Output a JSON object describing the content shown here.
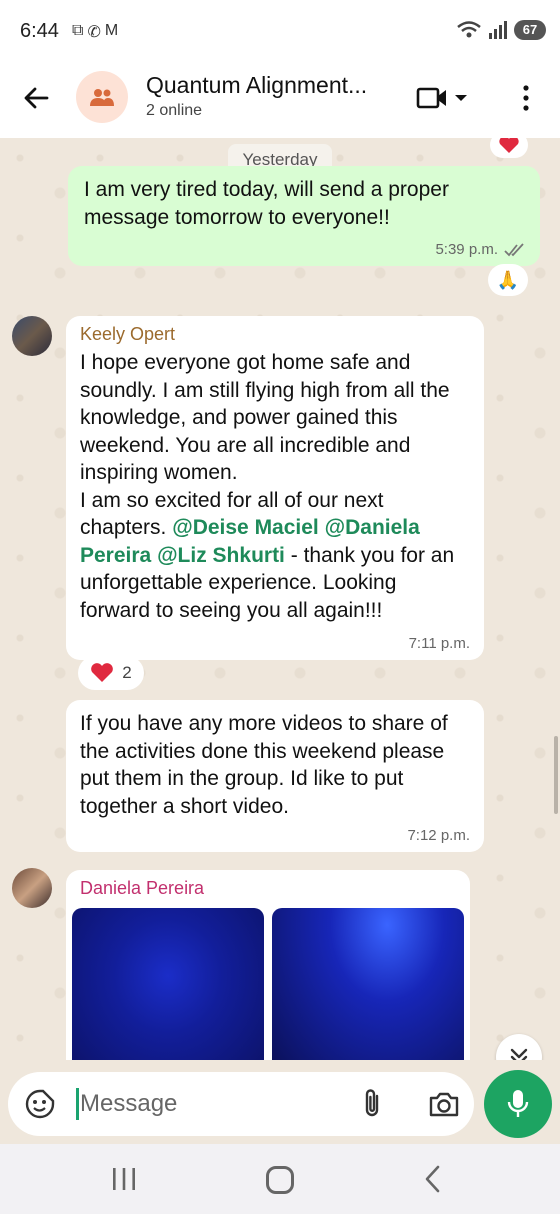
{
  "status_bar": {
    "time": "6:44",
    "battery": "67",
    "wifi_label": "6"
  },
  "header": {
    "title": "Quantum Alignment...",
    "subtitle": "2 online"
  },
  "chat": {
    "date_chip": "Yesterday",
    "outgoing": {
      "text": "I am very tired today, will send a proper message tomorrow to everyone!!",
      "time": "5:39 p.m.",
      "reaction": "🙏"
    },
    "message1": {
      "sender": "Keely Opert",
      "text_a": "I hope everyone got home safe and soundly. I am still flying high from all the knowledge, and power gained this weekend. You are all incredible and inspiring women.",
      "text_b": "I am so excited for all of our next chapters. ",
      "mention1": "@Deise Maciel",
      "mention2": "@Daniela Pereira",
      "mention3": "@Liz Shkurti",
      "text_c": " - thank you for an unforgettable experience. Looking forward to seeing you all again!!!",
      "time": "7:11 p.m.",
      "reaction_count": "2"
    },
    "message2": {
      "text": "If you have any more videos to share of the activities done this weekend please put them in the group. Id like to put together a short video.",
      "time": "7:12 p.m."
    },
    "message3": {
      "sender": "Daniela Pereira"
    }
  },
  "composer": {
    "placeholder": "Message"
  },
  "colors": {
    "accent_green": "#1da462",
    "outgoing_bubble": "#d9fdd3",
    "mention": "#1e8a5a"
  }
}
